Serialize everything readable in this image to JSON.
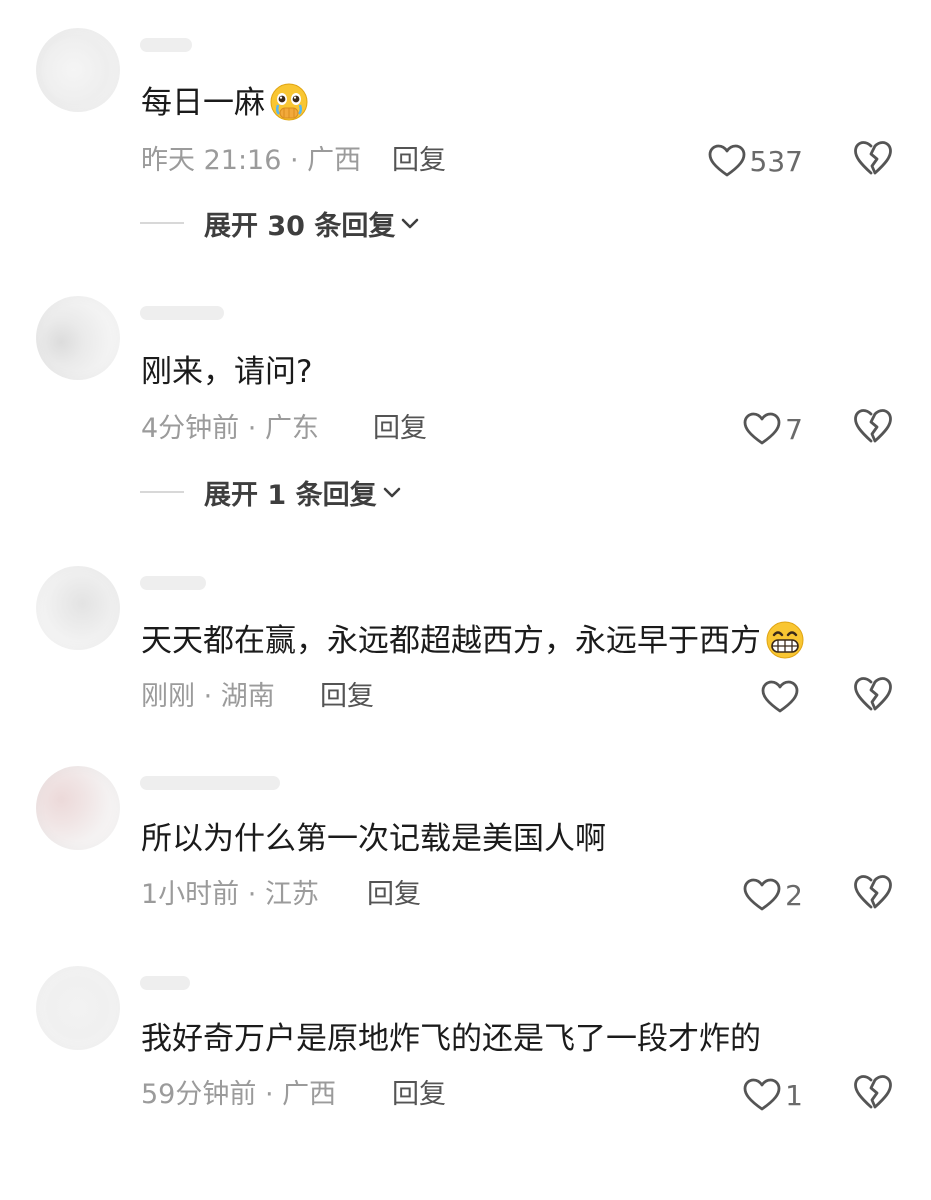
{
  "comments": [
    {
      "text": "每日一麻",
      "emoji": "pleading-face",
      "time": "昨天 21:16",
      "location": "广西",
      "reply_label": "回复",
      "likes": "537",
      "expand_label": "展开 30 条回复"
    },
    {
      "text": "刚来，请问?",
      "time": "4分钟前",
      "location": "广东",
      "reply_label": "回复",
      "likes": "7",
      "expand_label": "展开 1 条回复"
    },
    {
      "text": "天天都在赢，永远都超越西方，永远早于西方",
      "emoji": "grinning-face",
      "time": "刚刚",
      "location": "湖南",
      "reply_label": "回复",
      "likes": ""
    },
    {
      "text": "所以为什么第一次记载是美国人啊",
      "time": "1小时前",
      "location": "江苏",
      "reply_label": "回复",
      "likes": "2"
    },
    {
      "text": "我好奇万户是原地炸飞的还是飞了一段才炸的",
      "time": "59分钟前",
      "location": "广西",
      "reply_label": "回复",
      "likes": "1"
    }
  ],
  "separator": "·",
  "icons": {
    "like": "heart-outline-icon",
    "dislike": "broken-heart-icon",
    "expand": "chevron-down-icon"
  },
  "colors": {
    "text": "#1b1b1b",
    "meta": "#9b9b9b",
    "reply": "#545454",
    "icon": "#555555"
  }
}
